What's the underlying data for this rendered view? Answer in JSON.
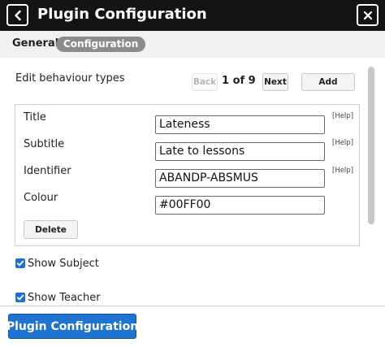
{
  "titlebar": {
    "title": "Plugin Configuration",
    "back_icon": "chevron-left-icon",
    "close_icon": "close-icon"
  },
  "tabs": [
    {
      "label": "General",
      "active": false
    },
    {
      "label": "Configuration",
      "active": true
    }
  ],
  "section": {
    "title": "Edit behaviour types",
    "pager": {
      "back_label": "Back",
      "count_label": "1 of 9",
      "next_label": "Next",
      "add_label": "Add"
    }
  },
  "form": {
    "fields": [
      {
        "label": "Title",
        "value": "Lateness",
        "help": "[Help]"
      },
      {
        "label": "Subtitle",
        "value": "Late to lessons",
        "help": "[Help]"
      },
      {
        "label": "Identifier",
        "value": "ABANDP-ABSMUS",
        "help": "[Help]"
      },
      {
        "label": "Colour",
        "value": "#00FF00"
      }
    ],
    "delete_label": "Delete"
  },
  "options": [
    {
      "label": "Show Subject",
      "checked": true
    },
    {
      "label": "Show Teacher",
      "checked": true
    }
  ],
  "footer": {
    "primary_label": "Plugin Configuration"
  },
  "colors": {
    "titlebar_bg": "#141414",
    "accent": "#1e74d2",
    "tab_active_bg": "#8c8c8c"
  }
}
